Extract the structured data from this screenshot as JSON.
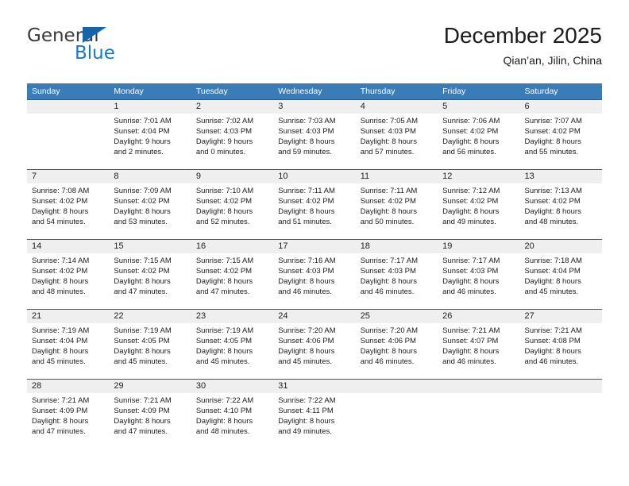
{
  "brand": {
    "name_part1": "General",
    "name_part2": "Blue"
  },
  "header": {
    "title": "December 2025",
    "subtitle": "Qian’an, Jilin, China"
  },
  "colors": {
    "header_blue": "#3a7cb8",
    "separator_blue": "#1f5fa0",
    "daynum_band": "#efefef",
    "brand_blue": "#1779c4"
  },
  "weekdays": [
    "Sunday",
    "Monday",
    "Tuesday",
    "Wednesday",
    "Thursday",
    "Friday",
    "Saturday"
  ],
  "weeks": [
    [
      {
        "day": "",
        "l1": "",
        "l2": "",
        "l3": "",
        "l4": ""
      },
      {
        "day": "1",
        "l1": "Sunrise: 7:01 AM",
        "l2": "Sunset: 4:04 PM",
        "l3": "Daylight: 9 hours",
        "l4": "and 2 minutes."
      },
      {
        "day": "2",
        "l1": "Sunrise: 7:02 AM",
        "l2": "Sunset: 4:03 PM",
        "l3": "Daylight: 9 hours",
        "l4": "and 0 minutes."
      },
      {
        "day": "3",
        "l1": "Sunrise: 7:03 AM",
        "l2": "Sunset: 4:03 PM",
        "l3": "Daylight: 8 hours",
        "l4": "and 59 minutes."
      },
      {
        "day": "4",
        "l1": "Sunrise: 7:05 AM",
        "l2": "Sunset: 4:03 PM",
        "l3": "Daylight: 8 hours",
        "l4": "and 57 minutes."
      },
      {
        "day": "5",
        "l1": "Sunrise: 7:06 AM",
        "l2": "Sunset: 4:02 PM",
        "l3": "Daylight: 8 hours",
        "l4": "and 56 minutes."
      },
      {
        "day": "6",
        "l1": "Sunrise: 7:07 AM",
        "l2": "Sunset: 4:02 PM",
        "l3": "Daylight: 8 hours",
        "l4": "and 55 minutes."
      }
    ],
    [
      {
        "day": "7",
        "l1": "Sunrise: 7:08 AM",
        "l2": "Sunset: 4:02 PM",
        "l3": "Daylight: 8 hours",
        "l4": "and 54 minutes."
      },
      {
        "day": "8",
        "l1": "Sunrise: 7:09 AM",
        "l2": "Sunset: 4:02 PM",
        "l3": "Daylight: 8 hours",
        "l4": "and 53 minutes."
      },
      {
        "day": "9",
        "l1": "Sunrise: 7:10 AM",
        "l2": "Sunset: 4:02 PM",
        "l3": "Daylight: 8 hours",
        "l4": "and 52 minutes."
      },
      {
        "day": "10",
        "l1": "Sunrise: 7:11 AM",
        "l2": "Sunset: 4:02 PM",
        "l3": "Daylight: 8 hours",
        "l4": "and 51 minutes."
      },
      {
        "day": "11",
        "l1": "Sunrise: 7:11 AM",
        "l2": "Sunset: 4:02 PM",
        "l3": "Daylight: 8 hours",
        "l4": "and 50 minutes."
      },
      {
        "day": "12",
        "l1": "Sunrise: 7:12 AM",
        "l2": "Sunset: 4:02 PM",
        "l3": "Daylight: 8 hours",
        "l4": "and 49 minutes."
      },
      {
        "day": "13",
        "l1": "Sunrise: 7:13 AM",
        "l2": "Sunset: 4:02 PM",
        "l3": "Daylight: 8 hours",
        "l4": "and 48 minutes."
      }
    ],
    [
      {
        "day": "14",
        "l1": "Sunrise: 7:14 AM",
        "l2": "Sunset: 4:02 PM",
        "l3": "Daylight: 8 hours",
        "l4": "and 48 minutes."
      },
      {
        "day": "15",
        "l1": "Sunrise: 7:15 AM",
        "l2": "Sunset: 4:02 PM",
        "l3": "Daylight: 8 hours",
        "l4": "and 47 minutes."
      },
      {
        "day": "16",
        "l1": "Sunrise: 7:15 AM",
        "l2": "Sunset: 4:02 PM",
        "l3": "Daylight: 8 hours",
        "l4": "and 47 minutes."
      },
      {
        "day": "17",
        "l1": "Sunrise: 7:16 AM",
        "l2": "Sunset: 4:03 PM",
        "l3": "Daylight: 8 hours",
        "l4": "and 46 minutes."
      },
      {
        "day": "18",
        "l1": "Sunrise: 7:17 AM",
        "l2": "Sunset: 4:03 PM",
        "l3": "Daylight: 8 hours",
        "l4": "and 46 minutes."
      },
      {
        "day": "19",
        "l1": "Sunrise: 7:17 AM",
        "l2": "Sunset: 4:03 PM",
        "l3": "Daylight: 8 hours",
        "l4": "and 46 minutes."
      },
      {
        "day": "20",
        "l1": "Sunrise: 7:18 AM",
        "l2": "Sunset: 4:04 PM",
        "l3": "Daylight: 8 hours",
        "l4": "and 45 minutes."
      }
    ],
    [
      {
        "day": "21",
        "l1": "Sunrise: 7:19 AM",
        "l2": "Sunset: 4:04 PM",
        "l3": "Daylight: 8 hours",
        "l4": "and 45 minutes."
      },
      {
        "day": "22",
        "l1": "Sunrise: 7:19 AM",
        "l2": "Sunset: 4:05 PM",
        "l3": "Daylight: 8 hours",
        "l4": "and 45 minutes."
      },
      {
        "day": "23",
        "l1": "Sunrise: 7:19 AM",
        "l2": "Sunset: 4:05 PM",
        "l3": "Daylight: 8 hours",
        "l4": "and 45 minutes."
      },
      {
        "day": "24",
        "l1": "Sunrise: 7:20 AM",
        "l2": "Sunset: 4:06 PM",
        "l3": "Daylight: 8 hours",
        "l4": "and 45 minutes."
      },
      {
        "day": "25",
        "l1": "Sunrise: 7:20 AM",
        "l2": "Sunset: 4:06 PM",
        "l3": "Daylight: 8 hours",
        "l4": "and 46 minutes."
      },
      {
        "day": "26",
        "l1": "Sunrise: 7:21 AM",
        "l2": "Sunset: 4:07 PM",
        "l3": "Daylight: 8 hours",
        "l4": "and 46 minutes."
      },
      {
        "day": "27",
        "l1": "Sunrise: 7:21 AM",
        "l2": "Sunset: 4:08 PM",
        "l3": "Daylight: 8 hours",
        "l4": "and 46 minutes."
      }
    ],
    [
      {
        "day": "28",
        "l1": "Sunrise: 7:21 AM",
        "l2": "Sunset: 4:09 PM",
        "l3": "Daylight: 8 hours",
        "l4": "and 47 minutes."
      },
      {
        "day": "29",
        "l1": "Sunrise: 7:21 AM",
        "l2": "Sunset: 4:09 PM",
        "l3": "Daylight: 8 hours",
        "l4": "and 47 minutes."
      },
      {
        "day": "30",
        "l1": "Sunrise: 7:22 AM",
        "l2": "Sunset: 4:10 PM",
        "l3": "Daylight: 8 hours",
        "l4": "and 48 minutes."
      },
      {
        "day": "31",
        "l1": "Sunrise: 7:22 AM",
        "l2": "Sunset: 4:11 PM",
        "l3": "Daylight: 8 hours",
        "l4": "and 49 minutes."
      },
      {
        "day": "",
        "l1": "",
        "l2": "",
        "l3": "",
        "l4": ""
      },
      {
        "day": "",
        "l1": "",
        "l2": "",
        "l3": "",
        "l4": ""
      },
      {
        "day": "",
        "l1": "",
        "l2": "",
        "l3": "",
        "l4": ""
      }
    ]
  ]
}
